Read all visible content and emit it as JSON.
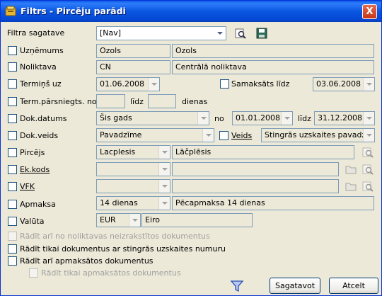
{
  "window": {
    "title": "Filtrs - Pircēju parādi",
    "close": "X"
  },
  "template": {
    "label": "Filtra sagatave",
    "value": "[Nav]"
  },
  "rows": {
    "uznemums": {
      "label": "Uzņēmums",
      "code": "Ozols",
      "name": "Ozols"
    },
    "noliktava": {
      "label": "Noliktava",
      "code": "CN",
      "name": "Centrālā noliktava"
    },
    "termins": {
      "label": "Termiņš uz",
      "date": "01.06.2008"
    },
    "samaksats": {
      "label": "Samaksāts līdz",
      "date": "03.06.2008"
    },
    "term_parsniegts": {
      "label": "Term.pārsniegts. no",
      "lidz": "līdz",
      "dienas": "dienas",
      "from": "",
      "to": ""
    },
    "dok_datums": {
      "label": "Dok.datums",
      "period": "Šis gads",
      "no": "no",
      "from": "01.01.2008",
      "lidz": "līdz",
      "to": "31.12.2008"
    },
    "dok_veids": {
      "label": "Dok.veids",
      "value": "Pavadzīme",
      "veids_label": "Veids",
      "veids_value": "Stingrās uzskaites pavadzīme"
    },
    "pircejs": {
      "label": "Pircējs",
      "code": "Lacplesis",
      "name": "Lāčplēsis"
    },
    "ek_kods": {
      "label": "Ek.kods",
      "code": "",
      "name": ""
    },
    "vfk": {
      "label": "VFK",
      "code": "",
      "name": ""
    },
    "apmaksa": {
      "label": "Apmaksa",
      "code": "14 dienas",
      "name": "Pēcapmaksa 14 dienas"
    },
    "valuta": {
      "label": "Valūta",
      "code": "EUR",
      "name": "Eiro"
    }
  },
  "options": {
    "neizrakstitos": "Rādīt arī no noliktavas neizrakstītos dokumentus",
    "stingras": "Rādīt tikai dokumentus ar stingrās uzskaites numuru",
    "apmaksatos": "Rādīt arī apmaksātos dokumentus",
    "tikai_apmaksatos": "Rādīt tikai apmaksātos dokumentus"
  },
  "buttons": {
    "generate": "Sagatavot",
    "cancel": "Atcelt"
  },
  "colors": {
    "title_bar": "#0a57e1",
    "dialog_bg": "#ece9d8",
    "border": "#7f9db9"
  }
}
